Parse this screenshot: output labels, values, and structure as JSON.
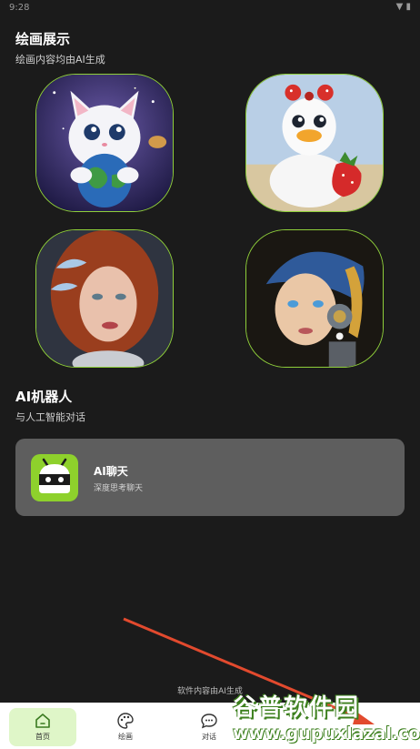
{
  "status_bar": {
    "time": "9:28",
    "icons": "▼ ▮"
  },
  "gallery": {
    "title": "绘画展示",
    "subtitle": "绘画内容均由AI生成",
    "images": [
      {
        "subject": "white cat hugging earth in space"
      },
      {
        "subject": "white duck with red bow holding strawberry"
      },
      {
        "subject": "red-haired woman with crystal fish"
      },
      {
        "subject": "robotic girl with blue headscarf and pearl earring"
      }
    ]
  },
  "robot": {
    "title": "AI机器人",
    "subtitle": "与人工智能对话",
    "chat_card": {
      "title": "AI聊天",
      "subtitle": "深度思考聊天",
      "icon": "android-robot-icon"
    }
  },
  "footer_note": "软件内容由AI生成",
  "bottom_nav": [
    {
      "label": "首页",
      "icon": "home-icon",
      "active": true
    },
    {
      "label": "绘画",
      "icon": "palette-icon",
      "active": false
    },
    {
      "label": "对话",
      "icon": "chat-bubble-icon",
      "active": false
    }
  ],
  "watermark": {
    "name": "谷普软件园",
    "url": "www.gupuxlazal.com"
  },
  "colors": {
    "accent": "#8ed12c",
    "card_bg": "#5e5e5e",
    "background": "#1b1b1b",
    "nav_active": "#dff6c8"
  }
}
